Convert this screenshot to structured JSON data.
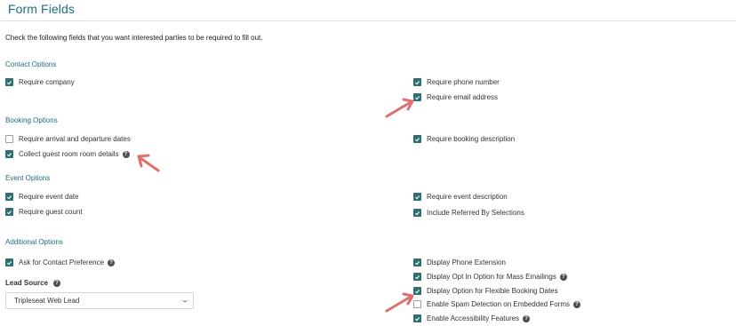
{
  "header": {
    "title": "Form Fields"
  },
  "intro": "Check the following fields that you want interested parties to be required to fill out.",
  "sections": {
    "contact": "Contact Options",
    "booking": "Booking Options",
    "event": "Event Options",
    "additional": "Additional Options"
  },
  "contact": {
    "require_company": "Require company",
    "require_phone": "Require phone number",
    "require_email": "Require email address"
  },
  "booking": {
    "require_dates": "Require arrival and departure dates",
    "collect_room_details": "Collect guest room room details",
    "require_description": "Require booking description"
  },
  "event": {
    "require_date": "Require event date",
    "require_guest_count": "Require guest count",
    "require_description": "Require event description",
    "include_referred": "Include Referred By Selections"
  },
  "additional": {
    "contact_preference": "Ask for Contact Preference",
    "phone_extension": "Display Phone Extension",
    "opt_in": "Display Opt In Option for Mass Emailings",
    "flexible_dates": "Display Option for Flexible Booking Dates",
    "spam_detection": "Enable Spam Detection on Embedded Forms",
    "accessibility": "Enable Accessibility Features"
  },
  "lead_source": {
    "label": "Lead Source",
    "selected": "Tripleseat Web Lead"
  },
  "colors": {
    "accent": "#1f6e7a",
    "checkbox": "#2e7072",
    "annotation_arrow": "#e07070"
  }
}
